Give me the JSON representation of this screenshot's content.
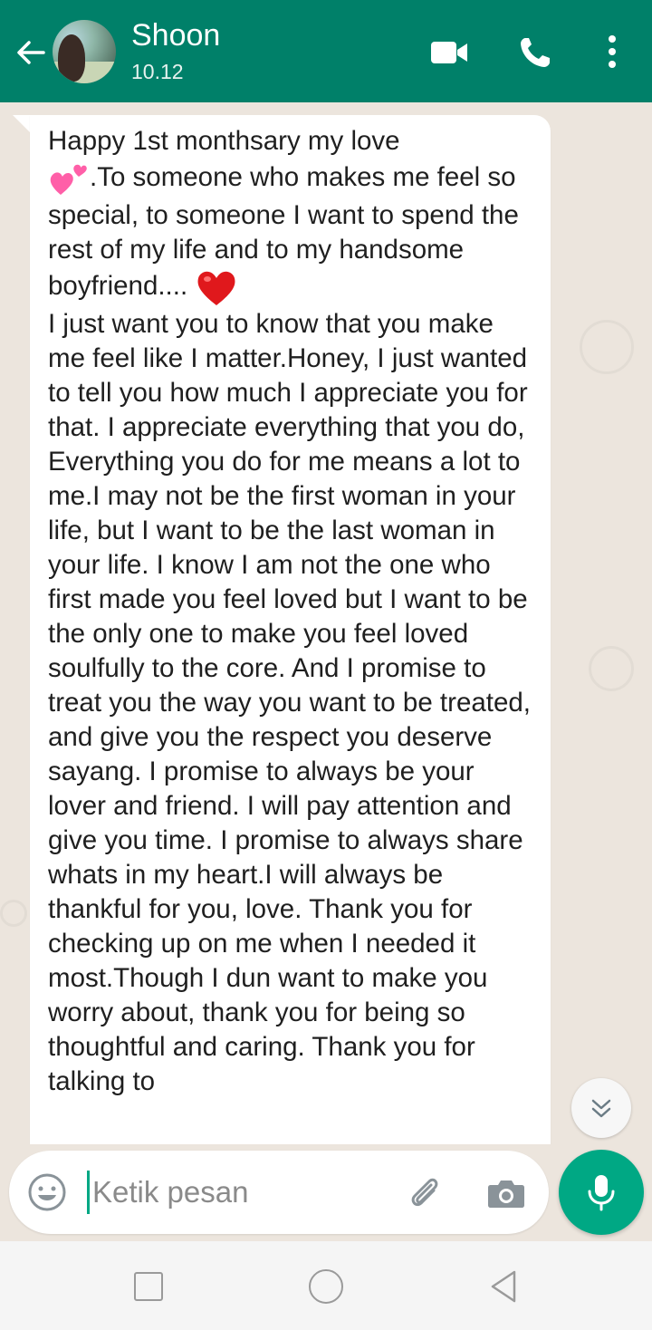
{
  "header": {
    "contact_name": "Shoon",
    "status": "10.12",
    "back_icon": "arrow-left-icon",
    "video_icon": "video-camera-icon",
    "call_icon": "phone-icon",
    "menu_icon": "more-vertical-icon",
    "color": "#008069"
  },
  "message": {
    "line1": "Happy 1st monthsary my love",
    "line2": ".To someone who makes me feel so special, to someone I want to spend the rest of my life and to my handsome boyfriend....",
    "body": "I just want you to know that you make me feel like I matter.Honey, I just wanted to tell you how much I appreciate you for that. I appreciate everything that you do, Everything you do for me means a lot to me.I may not be the first woman in your life, but I want to be the last woman in your life. I know I am not the one who first made you feel loved but I want to be the only one to make you feel loved soulfully to the core. And I promise to treat you the way you want to be treated, and give you the respect you deserve sayang. I promise to always be your lover and friend. I will pay attention and give you time. I promise to always share whats in my heart.I will always be thankful for you, love. Thank you for checking up on me when I needed it most.Though I dun want to make you worry about, thank you for being so thoughtful and caring. Thank you for talking to",
    "emoji_1": "two-hearts-icon",
    "emoji_2": "red-heart-icon"
  },
  "input": {
    "placeholder": "Ketik pesan",
    "emoji_icon": "smiley-icon",
    "attach_icon": "paperclip-icon",
    "camera_icon": "camera-icon",
    "mic_icon": "microphone-icon",
    "accent": "#00a884"
  },
  "scroll_button_icon": "chevron-double-down-icon",
  "navbar": {
    "recent_icon": "square-icon",
    "home_icon": "circle-icon",
    "back_icon": "triangle-back-icon"
  }
}
